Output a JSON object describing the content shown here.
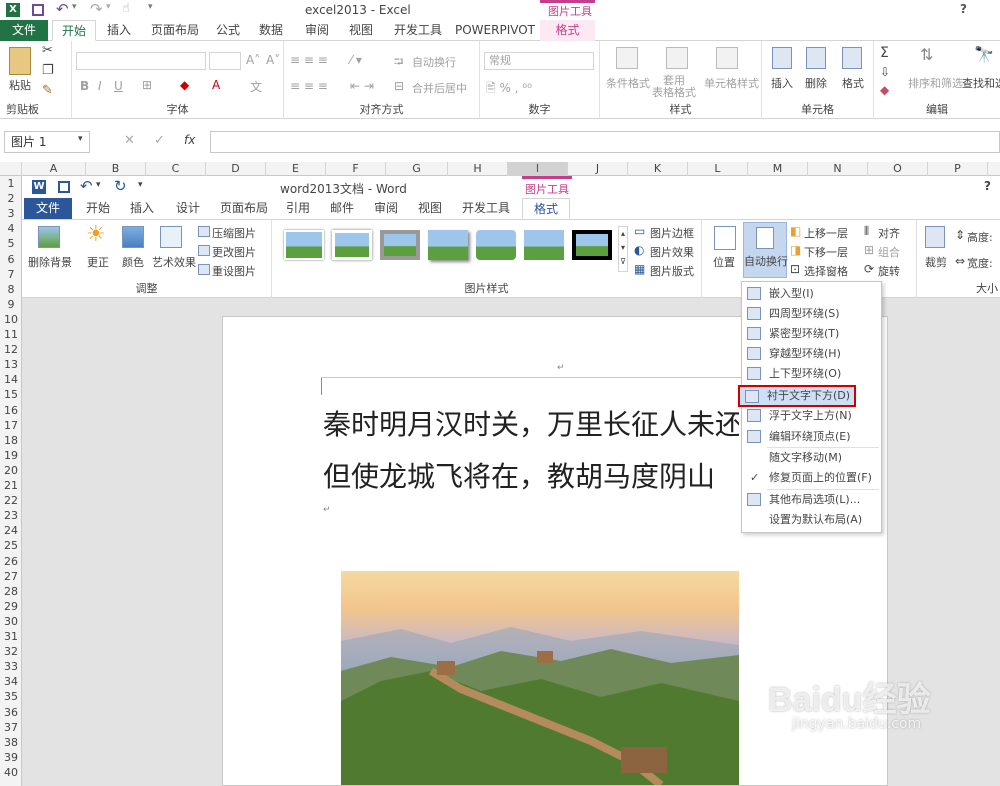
{
  "excel": {
    "title": "excel2013 - Excel",
    "help": "?",
    "tool_context": "图片工具",
    "tabs": [
      "文件",
      "开始",
      "插入",
      "页面布局",
      "公式",
      "数据",
      "审阅",
      "视图",
      "开发工具",
      "POWERPIVOT",
      "格式"
    ],
    "groups": [
      "剪贴板",
      "字体",
      "对齐方式",
      "数字",
      "样式",
      "单元格",
      "编辑"
    ],
    "buttons": {
      "paste": "粘贴",
      "wrap": "自动换行",
      "merge": "合并后居中",
      "number_format": "常规",
      "cond_format": "条件格式",
      "table_format": "套用\n表格格式",
      "cell_style": "单元格样式",
      "insert": "插入",
      "delete": "删除",
      "format": "格式",
      "sort": "排序和筛选",
      "find": "查找和选"
    },
    "name_box": "图片 1",
    "fx": "fx",
    "columns": [
      "A",
      "B",
      "C",
      "D",
      "E",
      "F",
      "G",
      "H",
      "I",
      "J",
      "K",
      "L",
      "M",
      "N",
      "O",
      "P"
    ],
    "rows": [
      "1",
      "2",
      "3",
      "4",
      "5",
      "6",
      "7",
      "8",
      "9",
      "10",
      "11",
      "12",
      "13",
      "14",
      "15",
      "16",
      "17",
      "18",
      "19",
      "20",
      "21",
      "22",
      "23",
      "24",
      "25",
      "26",
      "27",
      "28",
      "29",
      "30",
      "31",
      "32",
      "33",
      "34",
      "35",
      "36",
      "37",
      "38",
      "39",
      "40"
    ]
  },
  "word": {
    "title": "word2013文档 - Word",
    "help": "?",
    "tool_context": "图片工具",
    "tabs": [
      "文件",
      "开始",
      "插入",
      "设计",
      "页面布局",
      "引用",
      "邮件",
      "审阅",
      "视图",
      "开发工具",
      "格式"
    ],
    "adjust": {
      "remove_bg": "删除背景",
      "correct": "更正",
      "color": "颜色",
      "artistic": "艺术效果",
      "compress": "压缩图片",
      "change": "更改图片",
      "reset": "重设图片",
      "group": "调整"
    },
    "styles_group": "图片样式",
    "style_side": [
      "图片边框",
      "图片效果",
      "图片版式"
    ],
    "arrange": {
      "position": "位置",
      "wrap_text": "自动换行",
      "forward": "上移一层",
      "backward": "下移一层",
      "select_pane": "选择窗格",
      "align": "对齐",
      "group": "组合",
      "rotate": "旋转"
    },
    "size": {
      "crop": "裁剪",
      "height": "高度:",
      "width": "宽度:",
      "group": "大小"
    },
    "doc_lines": [
      "秦时明月汉时关，万里长征人未还",
      "但使龙城飞将在，教胡马度阴山"
    ]
  },
  "menu": [
    {
      "label": "嵌入型(I)"
    },
    {
      "label": "四周型环绕(S)"
    },
    {
      "label": "紧密型环绕(T)"
    },
    {
      "label": "穿越型环绕(H)"
    },
    {
      "label": "上下型环绕(O)"
    },
    {
      "label": "衬于文字下方(D)",
      "highlight": true
    },
    {
      "label": "浮于文字上方(N)"
    },
    {
      "label": "编辑环绕顶点(E)"
    },
    {
      "label": "随文字移动(M)"
    },
    {
      "label": "修复页面上的位置(F)",
      "checked": true
    },
    {
      "label": "其他布局选项(L)..."
    },
    {
      "label": "设置为默认布局(A)"
    }
  ],
  "watermark": {
    "main": "Baidu经验",
    "sub": "jingyan.baidu.com"
  },
  "colors": {
    "excel_green": "#217346",
    "word_blue": "#2b579a",
    "tool_pink": "#c43e8c",
    "highlight_red": "#d00000"
  }
}
